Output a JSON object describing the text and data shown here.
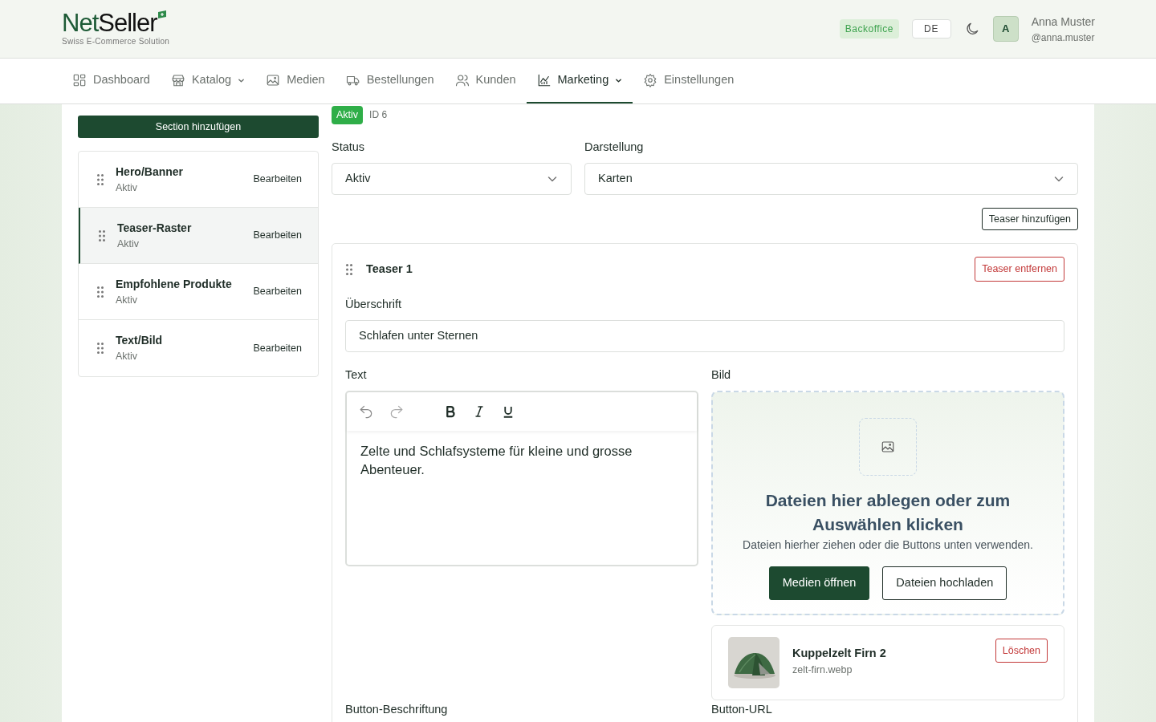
{
  "brand": {
    "name_part1": "Net",
    "name_part2": "Seller",
    "tagline": "Swiss E-Commerce Solution"
  },
  "header": {
    "env_badge": "Backoffice",
    "language": "DE",
    "user": {
      "initial": "A",
      "name": "Anna Muster",
      "handle": "@anna.muster"
    }
  },
  "nav": [
    {
      "label": "Dashboard",
      "dropdown": false,
      "selected": false
    },
    {
      "label": "Katalog",
      "dropdown": true,
      "selected": false
    },
    {
      "label": "Medien",
      "dropdown": false,
      "selected": false
    },
    {
      "label": "Bestellungen",
      "dropdown": false,
      "selected": false
    },
    {
      "label": "Kunden",
      "dropdown": false,
      "selected": false
    },
    {
      "label": "Marketing",
      "dropdown": true,
      "selected": true
    },
    {
      "label": "Einstellungen",
      "dropdown": false,
      "selected": false
    }
  ],
  "sidebar": {
    "add_button": "Section hinzufügen",
    "sections": [
      {
        "title": "Hero/Banner",
        "status": "Aktiv",
        "action": "Bearbeiten",
        "selected": false
      },
      {
        "title": "Teaser-Raster",
        "status": "Aktiv",
        "action": "Bearbeiten",
        "selected": true
      },
      {
        "title": "Empfohlene Produkte",
        "status": "Aktiv",
        "action": "Bearbeiten",
        "selected": false
      },
      {
        "title": "Text/Bild",
        "status": "Aktiv",
        "action": "Bearbeiten",
        "selected": false
      }
    ]
  },
  "editor": {
    "status_badge": "Aktiv",
    "id_text": "ID 6",
    "fields": [
      {
        "label": "Status",
        "value": "Aktiv"
      },
      {
        "label": "Darstellung",
        "value": "Karten"
      }
    ],
    "add_teaser": "Teaser hinzufügen",
    "teaser": {
      "title": "Teaser 1",
      "remove": "Teaser entfernen",
      "heading_label": "Überschrift",
      "heading_value": "Schlafen unter Sternen",
      "text_label": "Text",
      "text_value": "Zelte und Schlafsysteme für kleine und grosse Abenteuer.",
      "image_label": "Bild",
      "drop_title": "Dateien hier ablegen oder zum Auswählen klicken",
      "drop_hint": "Dateien hierher ziehen oder die Buttons unten verwenden.",
      "open_media": "Medien öffnen",
      "upload": "Dateien hochladen",
      "file": {
        "kind": "picture",
        "name": "Kuppelzelt Firn 2",
        "filename": "zelt-firn.webp",
        "delete": "Löschen"
      },
      "bottom_labels": [
        "Button-Beschriftung",
        "Button-URL"
      ]
    }
  }
}
